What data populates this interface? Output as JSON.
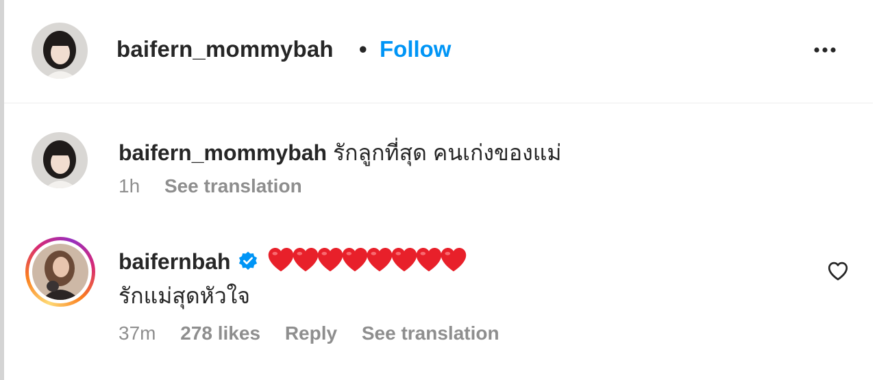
{
  "header": {
    "username": "baifern_mommybah",
    "separator": "•",
    "follow_label": "Follow",
    "more_icon": "more-horizontal-icon"
  },
  "caption": {
    "username": "baifern_mommybah",
    "text": "รักลูกที่สุด คนเก่งของแม่",
    "time": "1h",
    "translate_label": "See translation"
  },
  "reply": {
    "username": "baifernbah",
    "verified": true,
    "emoji_text": "❤️❤️❤️❤️❤️❤️❤️❤️",
    "heart_count": 8,
    "text": "รักแม่สุดหัวใจ",
    "time": "37m",
    "likes": "278 likes",
    "reply_label": "Reply",
    "translate_label": "See translation",
    "like_icon": "heart-outline-icon"
  },
  "colors": {
    "link_blue": "#0095f6",
    "verified_blue": "#0095f6",
    "heart_red": "#e8202a",
    "meta_gray": "#8e8e8e"
  }
}
